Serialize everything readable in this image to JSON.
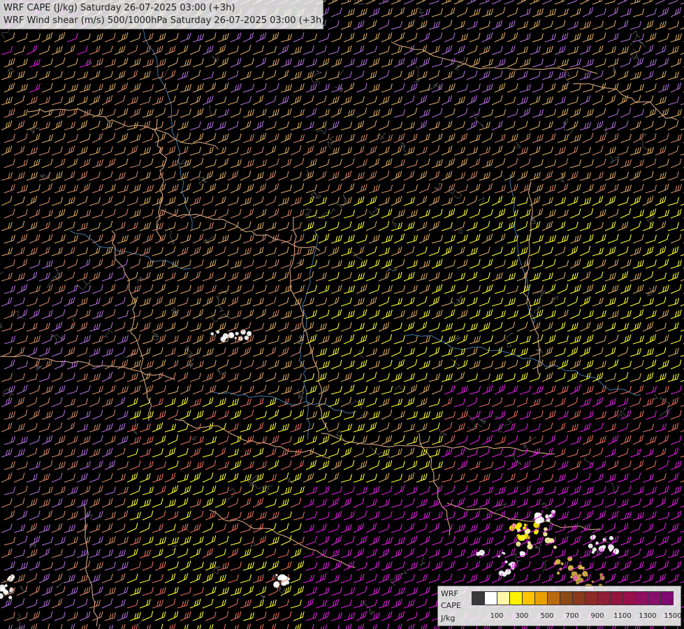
{
  "title": {
    "line1": "WRF CAPE (J/kg) Saturday 26-07-2025 03:00 (+3h)",
    "line2": "WRF Wind shear (m/s) 500/1000hPa Saturday 26-07-2025 03:00 (+3h)"
  },
  "legend": {
    "label_top": "WRF",
    "label_mid": "CAPE",
    "label_unit": "J/kg",
    "colors": [
      "#3a3a3a",
      "#ffffff",
      "#fff6a8",
      "#fff200",
      "#ffc400",
      "#e8a000",
      "#b86a10",
      "#8c4a14",
      "#8a3a1c",
      "#8c2a28",
      "#901e34",
      "#94163e",
      "#98104a",
      "#901060",
      "#88106c",
      "#800a70"
    ],
    "ticks": [
      "100",
      "300",
      "500",
      "700",
      "900",
      "1100",
      "1300",
      "1500"
    ]
  },
  "map": {
    "background": "#000000",
    "wind_barb_colors": [
      "#ffff33",
      "#d9aa66",
      "#d08868",
      "#e57060",
      "#b070d8",
      "#e020e0"
    ],
    "border_color": "#e8b48c",
    "river_color": "#5aa0e0",
    "terrain_contour_color": "#7a7a7a"
  }
}
